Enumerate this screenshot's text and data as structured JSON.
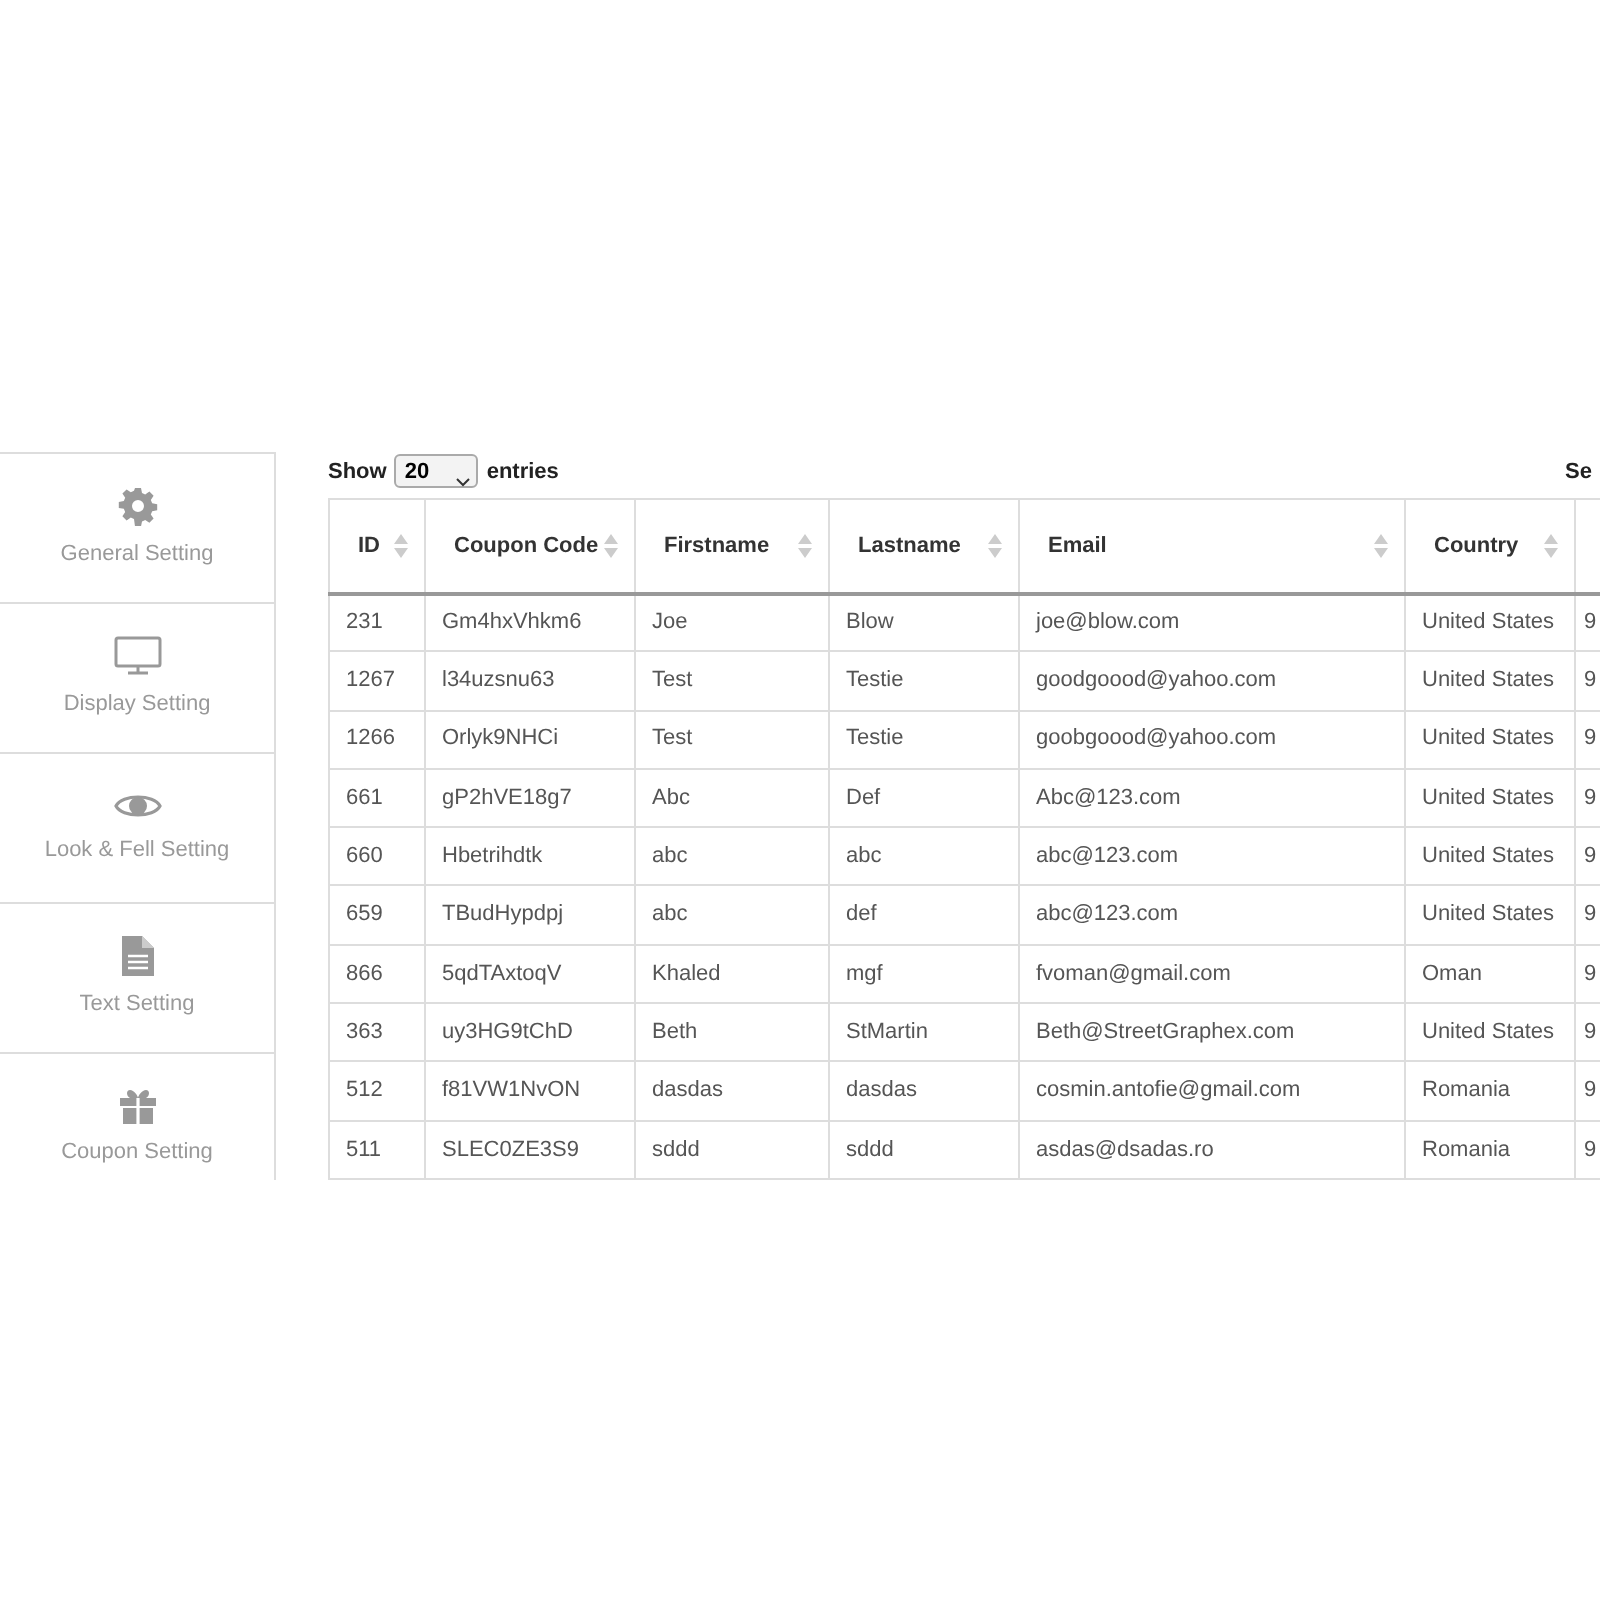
{
  "sidebar": {
    "items": [
      {
        "label": "General Setting"
      },
      {
        "label": "Display Setting"
      },
      {
        "label": "Look & Fell Setting"
      },
      {
        "label": "Text Setting"
      },
      {
        "label": "Coupon Setting"
      }
    ]
  },
  "length_control": {
    "prefix": "Show",
    "value": "20",
    "suffix": "entries"
  },
  "search_label": "Se",
  "table": {
    "columns": [
      {
        "label": "ID"
      },
      {
        "label": "Coupon Code"
      },
      {
        "label": "Firstname"
      },
      {
        "label": "Lastname"
      },
      {
        "label": "Email"
      },
      {
        "label": "Country"
      }
    ],
    "rows": [
      [
        "231",
        "Gm4hxVhkm6",
        "Joe",
        "Blow",
        "joe@blow.com",
        "United States",
        "9"
      ],
      [
        "1267",
        "l34uzsnu63",
        "Test",
        "Testie",
        "goodgoood@yahoo.com",
        "United States",
        "9"
      ],
      [
        "1266",
        "Orlyk9NHCi",
        "Test",
        "Testie",
        "goobgoood@yahoo.com",
        "United States",
        "9"
      ],
      [
        "661",
        "gP2hVE18g7",
        "Abc",
        "Def",
        "Abc@123.com",
        "United States",
        "9"
      ],
      [
        "660",
        "Hbetrihdtk",
        "abc",
        "abc",
        "abc@123.com",
        "United States",
        "9"
      ],
      [
        "659",
        "TBudHypdpj",
        "abc",
        "def",
        "abc@123.com",
        "United States",
        "9"
      ],
      [
        "866",
        "5qdTAxtoqV",
        "Khaled",
        "mgf",
        "fvoman@gmail.com",
        "Oman",
        "9"
      ],
      [
        "363",
        "uy3HG9tChD",
        "Beth",
        "StMartin",
        "Beth@StreetGraphex.com",
        "United States",
        "9"
      ],
      [
        "512",
        "f81VW1NvON",
        "dasdas",
        "dasdas",
        "cosmin.antofie@gmail.com",
        "Romania",
        "9"
      ],
      [
        "511",
        "SLEC0ZE3S9",
        "sddd",
        "sddd",
        "asdas@dsadas.ro",
        "Romania",
        "9"
      ]
    ]
  }
}
